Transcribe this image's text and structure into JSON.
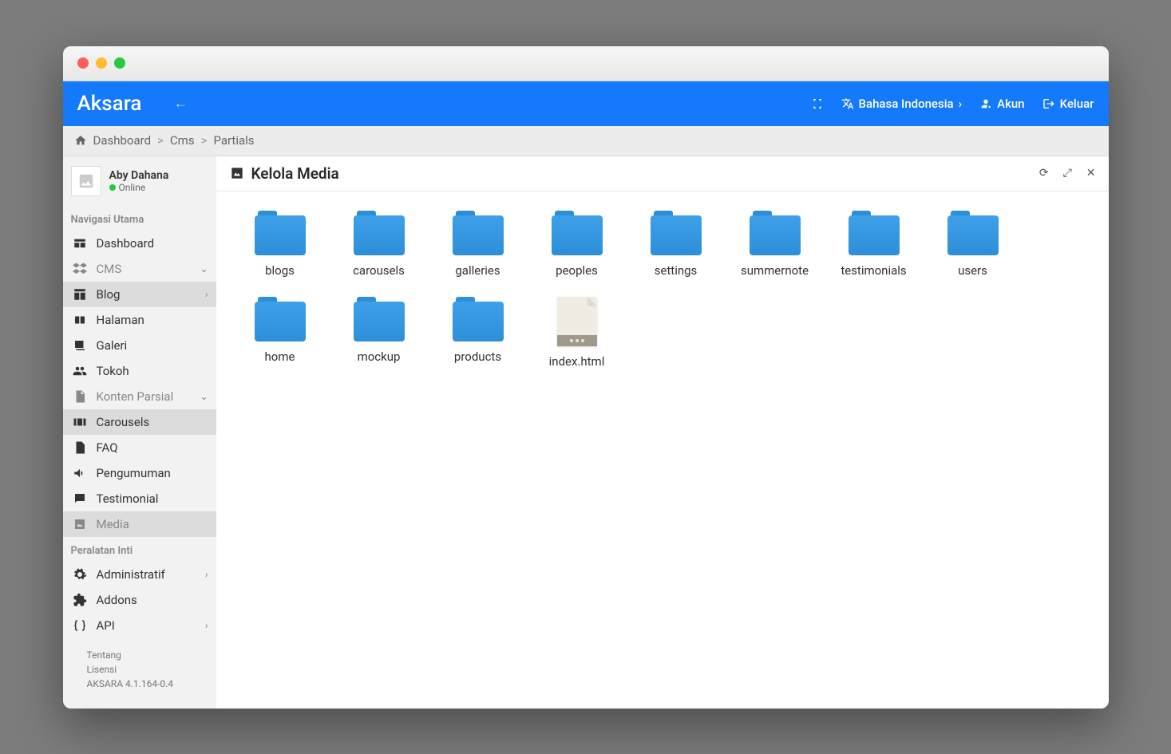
{
  "brand": "Aksara",
  "topbar": {
    "language": "Bahasa Indonesia",
    "account": "Akun",
    "logout": "Keluar"
  },
  "breadcrumbs": [
    "Dashboard",
    "Cms",
    "Partials"
  ],
  "profile": {
    "name": "Aby Dahana",
    "status": "Online"
  },
  "nav": {
    "main_header": "Navigasi Utama",
    "dashboard": "Dashboard",
    "cms": "CMS",
    "blog": "Blog",
    "halaman": "Halaman",
    "galeri": "Galeri",
    "tokoh": "Tokoh",
    "konten_parsial": "Konten Parsial",
    "carousels": "Carousels",
    "faq": "FAQ",
    "pengumuman": "Pengumuman",
    "testimonial": "Testimonial",
    "media": "Media",
    "tools_header": "Peralatan Inti",
    "administratif": "Administratif",
    "addons": "Addons",
    "api": "API"
  },
  "footer": {
    "tentang": "Tentang",
    "lisensi": "Lisensi",
    "version": "AKSARA 4.1.164-0.4"
  },
  "main": {
    "title": "Kelola Media"
  },
  "items": [
    {
      "label": "blogs",
      "type": "folder"
    },
    {
      "label": "carousels",
      "type": "folder"
    },
    {
      "label": "galleries",
      "type": "folder"
    },
    {
      "label": "peoples",
      "type": "folder"
    },
    {
      "label": "settings",
      "type": "folder"
    },
    {
      "label": "summernote",
      "type": "folder"
    },
    {
      "label": "testimonials",
      "type": "folder"
    },
    {
      "label": "users",
      "type": "folder"
    },
    {
      "label": "home",
      "type": "folder"
    },
    {
      "label": "mockup",
      "type": "folder"
    },
    {
      "label": "products",
      "type": "folder"
    },
    {
      "label": "index.html",
      "type": "file"
    }
  ]
}
